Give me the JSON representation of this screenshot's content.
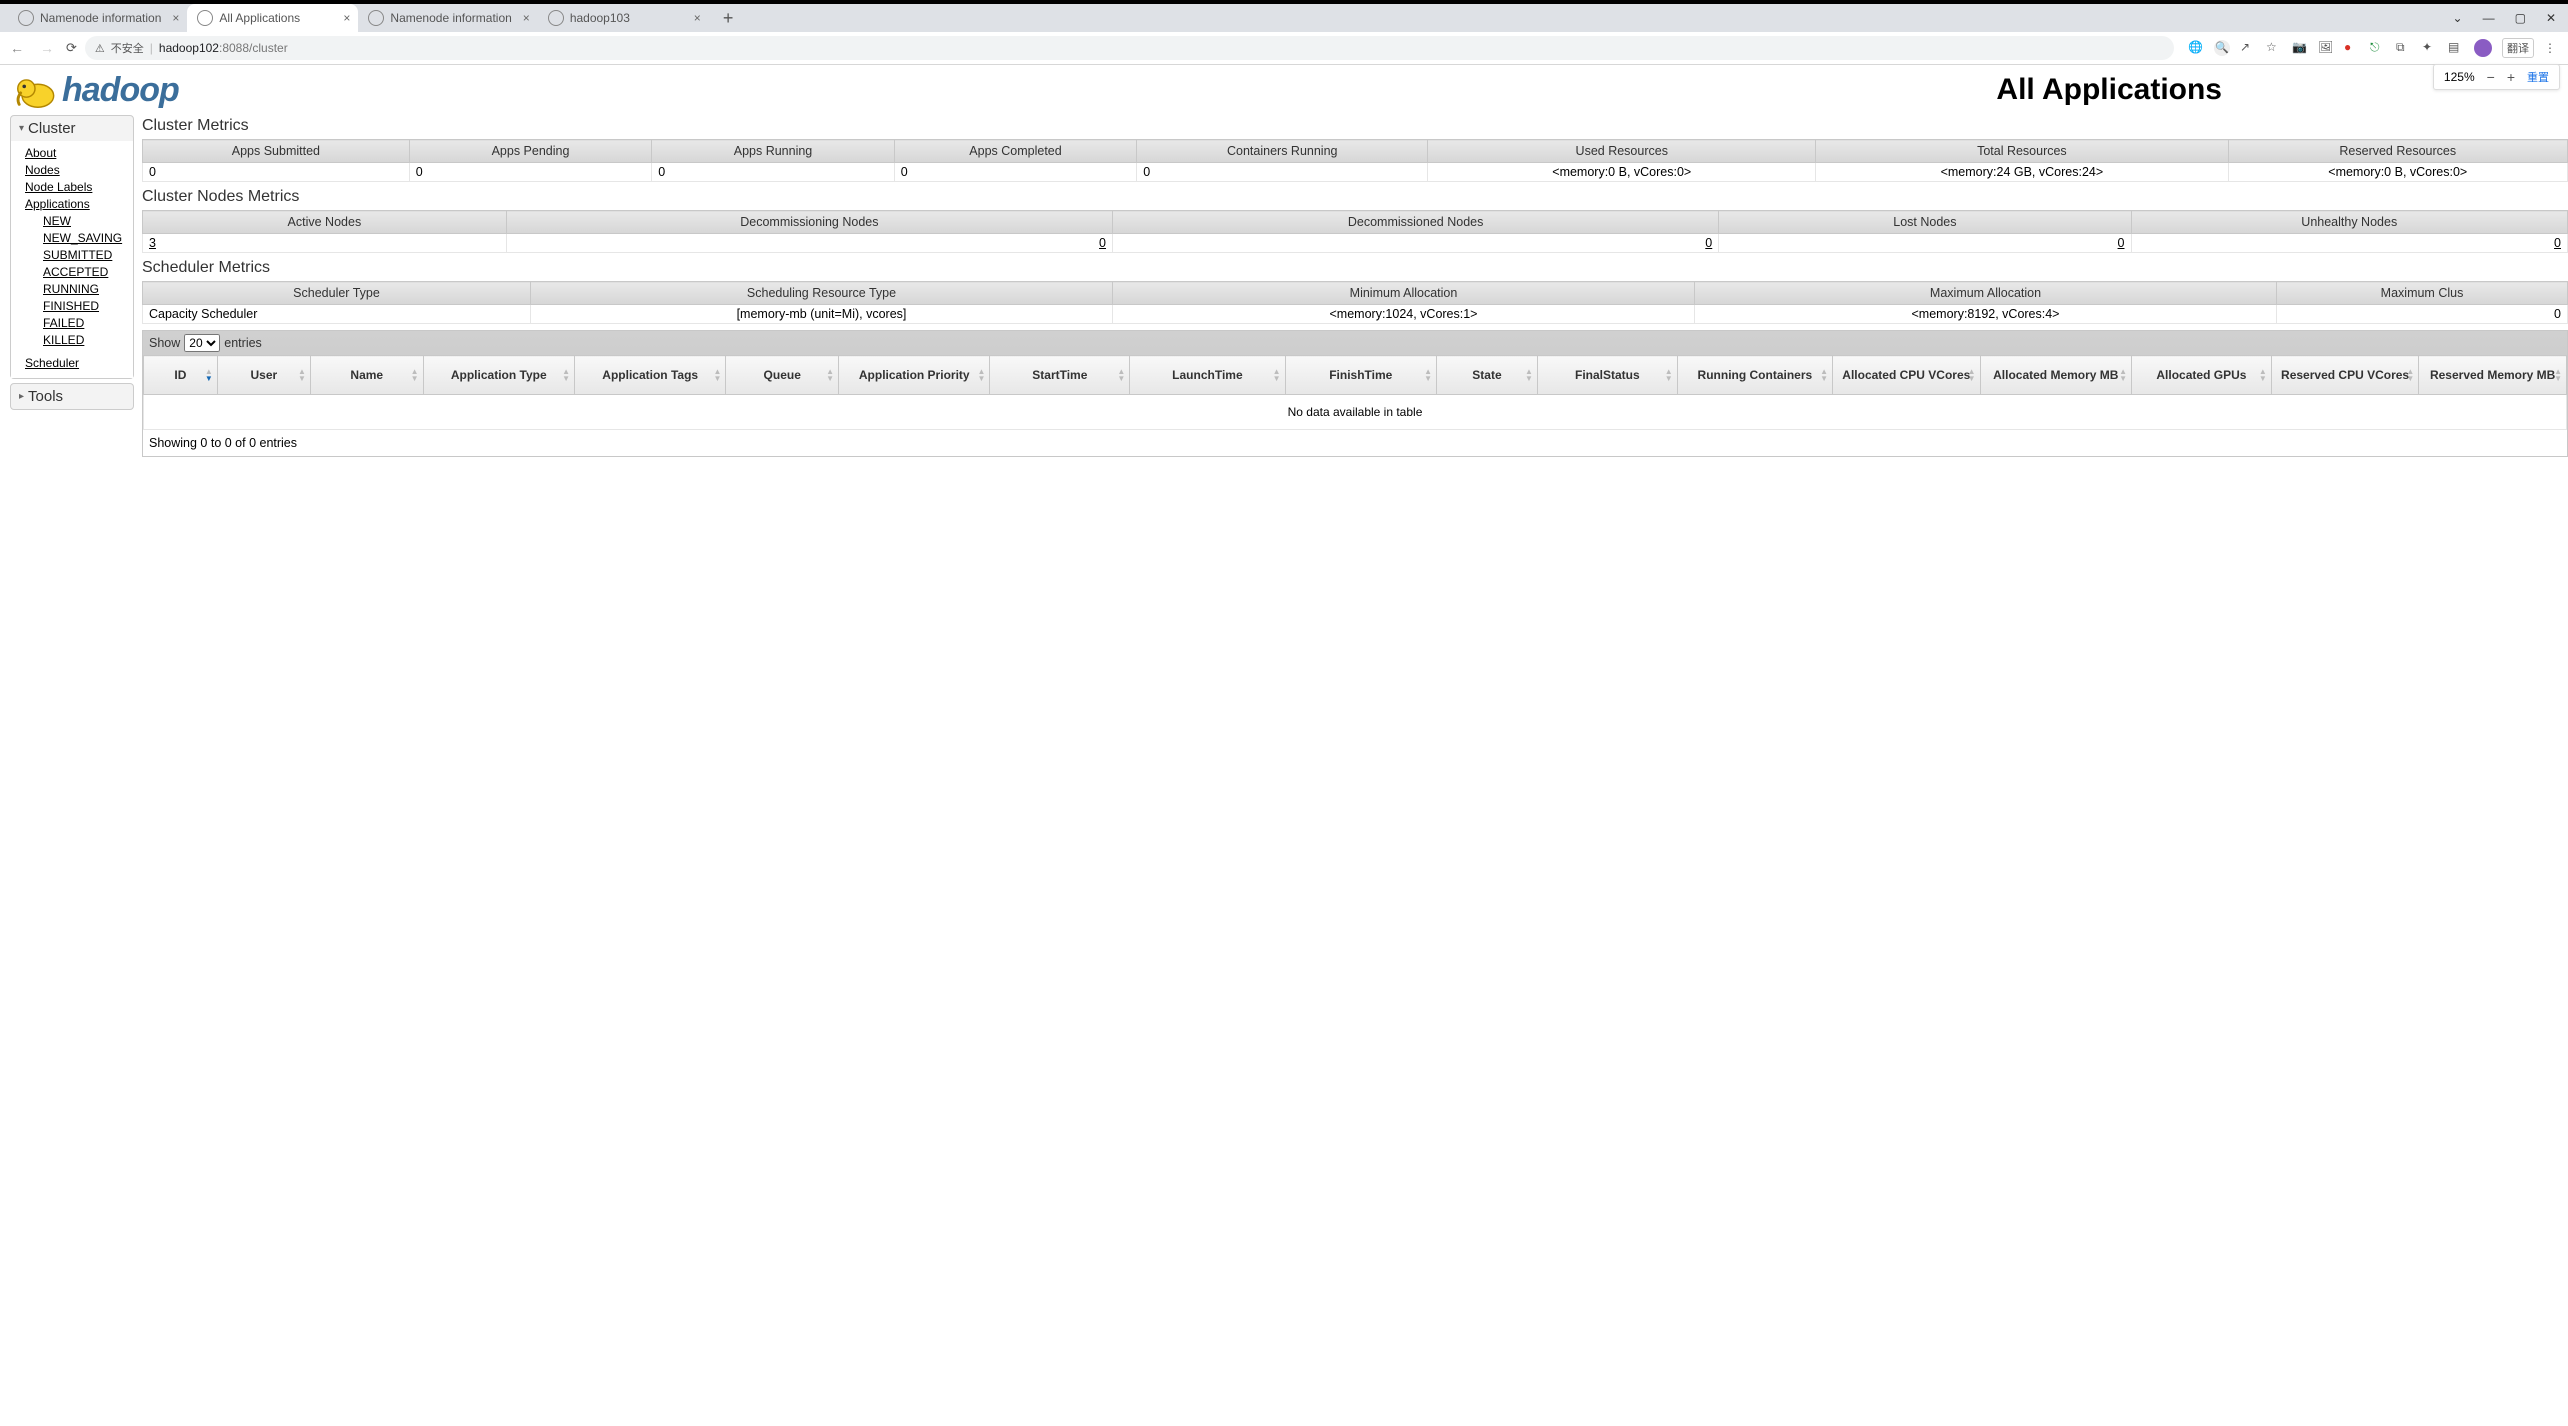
{
  "chrome": {
    "tabs": [
      {
        "label": "Namenode information"
      },
      {
        "label": "All Applications"
      },
      {
        "label": "Namenode information"
      },
      {
        "label": "hadoop103"
      }
    ],
    "active_tab_index": 1,
    "address_insecure_label": "不安全",
    "url_host": "hadoop102",
    "url_rest": ":8088/cluster",
    "translate_chip": "翻译",
    "window_controls": {
      "min": "—",
      "max": "▢",
      "close": "✕",
      "more": "⌄"
    },
    "zoom": {
      "level": "125%",
      "reset_label": "重置"
    }
  },
  "page": {
    "logo_text": "hadoop",
    "title": "All Applications"
  },
  "sidebar": {
    "cluster_label": "Cluster",
    "links": {
      "about": "About",
      "nodes": "Nodes",
      "node_labels": "Node Labels",
      "applications": "Applications",
      "scheduler": "Scheduler"
    },
    "app_states": {
      "new": "NEW",
      "new_saving": "NEW_SAVING",
      "submitted": "SUBMITTED",
      "accepted": "ACCEPTED",
      "running": "RUNNING",
      "finished": "FINISHED",
      "failed": "FAILED",
      "killed": "KILLED"
    },
    "tools_label": "Tools"
  },
  "cluster_metrics": {
    "section": "Cluster Metrics",
    "headers": {
      "apps_submitted": "Apps Submitted",
      "apps_pending": "Apps Pending",
      "apps_running": "Apps Running",
      "apps_completed": "Apps Completed",
      "containers_running": "Containers Running",
      "used_resources": "Used Resources",
      "total_resources": "Total Resources",
      "reserved_resources": "Reserved Resources"
    },
    "row": {
      "apps_submitted": "0",
      "apps_pending": "0",
      "apps_running": "0",
      "apps_completed": "0",
      "containers_running": "0",
      "used_resources": "<memory:0 B, vCores:0>",
      "total_resources": "<memory:24 GB, vCores:24>",
      "reserved_resources": "<memory:0 B, vCores:0>"
    }
  },
  "nodes_metrics": {
    "section": "Cluster Nodes Metrics",
    "headers": {
      "active": "Active Nodes",
      "decommissioning": "Decommissioning Nodes",
      "decommissioned": "Decommissioned Nodes",
      "lost": "Lost Nodes",
      "unhealthy": "Unhealthy Nodes"
    },
    "row": {
      "active": "3",
      "decommissioning": "0",
      "decommissioned": "0",
      "lost": "0",
      "unhealthy": "0"
    }
  },
  "scheduler_metrics": {
    "section": "Scheduler Metrics",
    "headers": {
      "type": "Scheduler Type",
      "resource_type": "Scheduling Resource Type",
      "min_alloc": "Minimum Allocation",
      "max_alloc": "Maximum Allocation",
      "max_cluster": "Maximum Clus"
    },
    "row": {
      "type": "Capacity Scheduler",
      "resource_type": "[memory-mb (unit=Mi), vcores]",
      "min_alloc": "<memory:1024, vCores:1>",
      "max_alloc": "<memory:8192, vCores:4>",
      "max_cluster": "0"
    }
  },
  "apps_table": {
    "show_label_pre": "Show",
    "show_value": "20",
    "show_label_post": "entries",
    "headers": {
      "id": "ID",
      "user": "User",
      "name": "Name",
      "app_type": "Application Type",
      "app_tags": "Application Tags",
      "queue": "Queue",
      "app_priority": "Application Priority",
      "start_time": "StartTime",
      "launch_time": "LaunchTime",
      "finish_time": "FinishTime",
      "state": "State",
      "final_status": "FinalStatus",
      "running_containers": "Running Containers",
      "alloc_cpu": "Allocated CPU VCores",
      "alloc_mem": "Allocated Memory MB",
      "alloc_gpus": "Allocated GPUs",
      "res_cpu": "Reserved CPU VCores",
      "res_mem": "Reserved Memory MB"
    },
    "no_data": "No data available in table",
    "footer_info": "Showing 0 to 0 of 0 entries"
  }
}
